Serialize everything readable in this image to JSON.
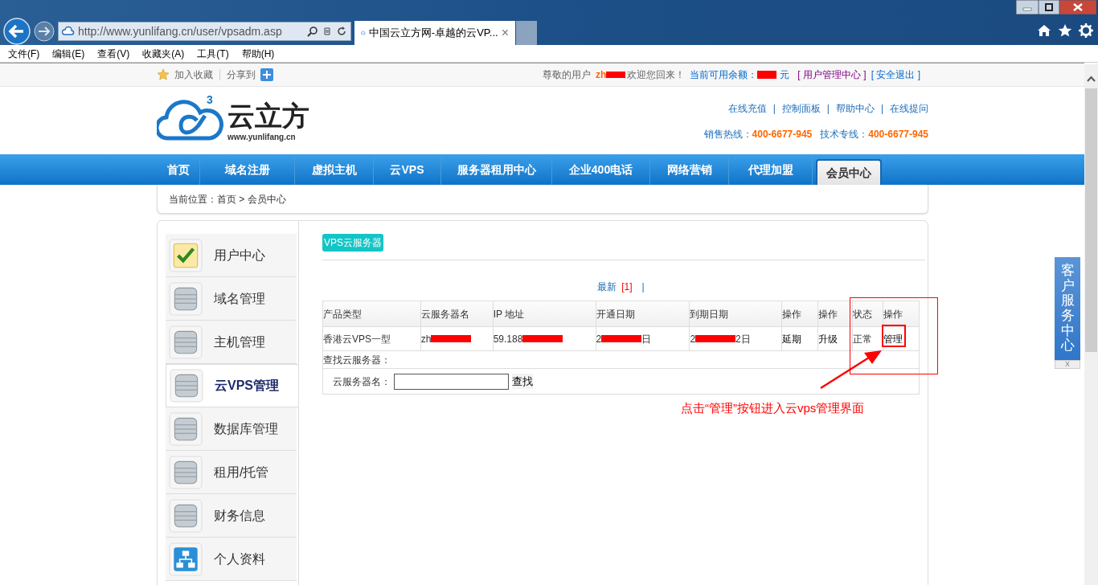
{
  "browser": {
    "address": "http://www.yunlifang.cn/user/vpsadm.asp",
    "tab_title": "中国云立方网-卓越的云VP...",
    "tab_close": "×",
    "menu": [
      "文件(F)",
      "编辑(E)",
      "查看(V)",
      "收藏夹(A)",
      "工具(T)",
      "帮助(H)"
    ]
  },
  "topbar": {
    "bookmark": "加入收藏",
    "share": "分享到",
    "greeting": "尊敬的用户",
    "user": {
      "text": "zh",
      "redacted": true
    },
    "welcome": "欢迎您回来！",
    "balance_label": "当前可用余额：",
    "balance": {
      "redacted": true
    },
    "currency": "元",
    "links": [
      {
        "text": "[ 用户管理中心 ]",
        "visited": true
      },
      {
        "text": "[ 安全退出 ]",
        "visited": false
      }
    ]
  },
  "header": {
    "logo_text": "云立方",
    "logo_url": "www.yunlifang.cn",
    "logo_sup": "3",
    "links": [
      "在线充值",
      "控制面板",
      "帮助中心",
      "在线提问"
    ],
    "link_separator": "|",
    "hotlines": [
      {
        "label": "销售热线：",
        "number": "400-6677-945"
      },
      {
        "label": "技术专线：",
        "number": "400-6677-945"
      }
    ]
  },
  "nav": [
    {
      "label": "首页",
      "selected": false
    },
    {
      "label": "域名注册",
      "selected": false
    },
    {
      "label": "虚拟主机",
      "selected": false
    },
    {
      "label": "云VPS",
      "selected": false
    },
    {
      "label": "服务器租用中心",
      "selected": false
    },
    {
      "label": "企业400电话",
      "selected": false
    },
    {
      "label": "网络营销",
      "selected": false
    },
    {
      "label": "代理加盟",
      "selected": false
    },
    {
      "label": "会员中心",
      "selected": true
    }
  ],
  "breadcrumb": "当前位置：首页 > 会员中心",
  "sidebar": [
    {
      "label": "用户中心",
      "kind": "check",
      "selected": false
    },
    {
      "label": "域名管理",
      "kind": "database",
      "selected": false
    },
    {
      "label": "主机管理",
      "kind": "database",
      "selected": false
    },
    {
      "label": "云VPS管理",
      "kind": "database",
      "selected": true
    },
    {
      "label": "数据库管理",
      "kind": "database",
      "selected": false
    },
    {
      "label": "租用/托管",
      "kind": "database",
      "selected": false
    },
    {
      "label": "财务信息",
      "kind": "database",
      "selected": false
    },
    {
      "label": "个人资料",
      "kind": "network",
      "selected": false
    }
  ],
  "section_tab": "VPS云服务器",
  "pager": {
    "latest": "最新",
    "page": "[1]",
    "separator": "|"
  },
  "table": {
    "columns": [
      "产品类型",
      "云服务器名",
      "IP 地址",
      "开通日期",
      "到期日期",
      "操作",
      "操作",
      "状态",
      "操作"
    ],
    "rows": [
      [
        {
          "text": "香港云VPS一型"
        },
        {
          "text": "zh",
          "redacted": true
        },
        {
          "text": "59.188",
          "redacted": true
        },
        {
          "text": "2",
          "redacted": true,
          "after": "日"
        },
        {
          "text": "2",
          "redacted": true,
          "after": "2日"
        },
        {
          "text": "延期",
          "kind": "action"
        },
        {
          "text": "升级",
          "kind": "action"
        },
        {
          "text": "正常"
        },
        {
          "text": "管理",
          "kind": "action"
        }
      ]
    ]
  },
  "search": {
    "title": "查找云服务器：",
    "label": "云服务器名：",
    "button": "查找"
  },
  "annotation": {
    "caption": "点击“管理”按钮进入云vps管理界面"
  },
  "float_service": {
    "label": "客户服务中心",
    "close": "X"
  }
}
